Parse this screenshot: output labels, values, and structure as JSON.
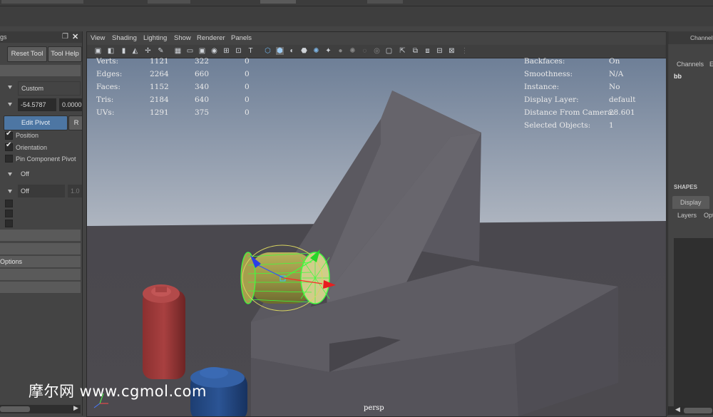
{
  "left_panel": {
    "title_fragment": "gs",
    "reset_tool": "Reset Tool",
    "tool_help": "Tool Help",
    "axis_mode": "Custom",
    "value_x": "-54.5787",
    "value_y": "0.0000",
    "edit_pivot": "Edit Pivot",
    "reset_fragment": "R",
    "position_label": "Position",
    "position_checked": true,
    "orientation_label": "Orientation",
    "orientation_checked": true,
    "pin_label": "Pin Component Pivot",
    "pin_checked": false,
    "dropdown1": "Off",
    "dropdown2": "Off",
    "dropdown2_value": "1.0",
    "options_label": "Options"
  },
  "viewport": {
    "menu": [
      "View",
      "Shading",
      "Lighting",
      "Show",
      "Renderer",
      "Panels"
    ],
    "camera_label": "persp",
    "hud_left": [
      {
        "label": "Verts:",
        "a": "1121",
        "b": "322",
        "c": "0"
      },
      {
        "label": "Edges:",
        "a": "2264",
        "b": "660",
        "c": "0"
      },
      {
        "label": "Faces:",
        "a": "1152",
        "b": "340",
        "c": "0"
      },
      {
        "label": "Tris:",
        "a": "2184",
        "b": "640",
        "c": "0"
      },
      {
        "label": "UVs:",
        "a": "1291",
        "b": "375",
        "c": "0"
      }
    ],
    "hud_right": [
      {
        "label": "Backfaces:",
        "value": "On"
      },
      {
        "label": "Smoothness:",
        "value": "N/A"
      },
      {
        "label": "Instance:",
        "value": "No"
      },
      {
        "label": "Display Layer:",
        "value": "default"
      },
      {
        "label": "Distance From Camera:",
        "value": "28.601"
      },
      {
        "label": "Selected Objects:",
        "value": "1"
      }
    ]
  },
  "right_panel": {
    "channel_title": "Channel",
    "channels_tab": "Channels",
    "edit_tab": "E",
    "object_name": "bb",
    "shapes_label": "SHAPES",
    "display_tab": "Display",
    "layers_tab": "Layers",
    "options_tab": "Opt"
  },
  "watermark": "摩尔网 www.cgmol.com",
  "colors": {
    "accent_blue": "#4d76a3",
    "sky_top": "#6a7d97",
    "ground": "#555359",
    "selection_green": "#3cff3c"
  }
}
